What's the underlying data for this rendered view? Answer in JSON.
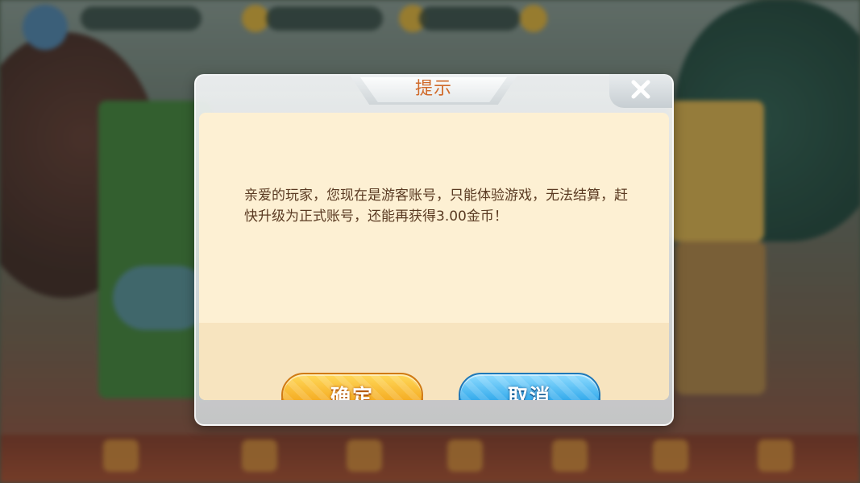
{
  "dialog": {
    "title": "提示",
    "message": "亲爱的玩家，您现在是游客账号，只能体验游戏，无法结算，赶快升级为正式账号，还能再获得3.00金币！",
    "confirm_label": "确定",
    "cancel_label": "取消",
    "close_icon": "close-icon"
  },
  "colors": {
    "title": "#d06a2a",
    "message": "#5a3a22",
    "panel": "#fdf0d3",
    "confirm_button": "#f6b22a",
    "cancel_button": "#3eb0ee"
  }
}
